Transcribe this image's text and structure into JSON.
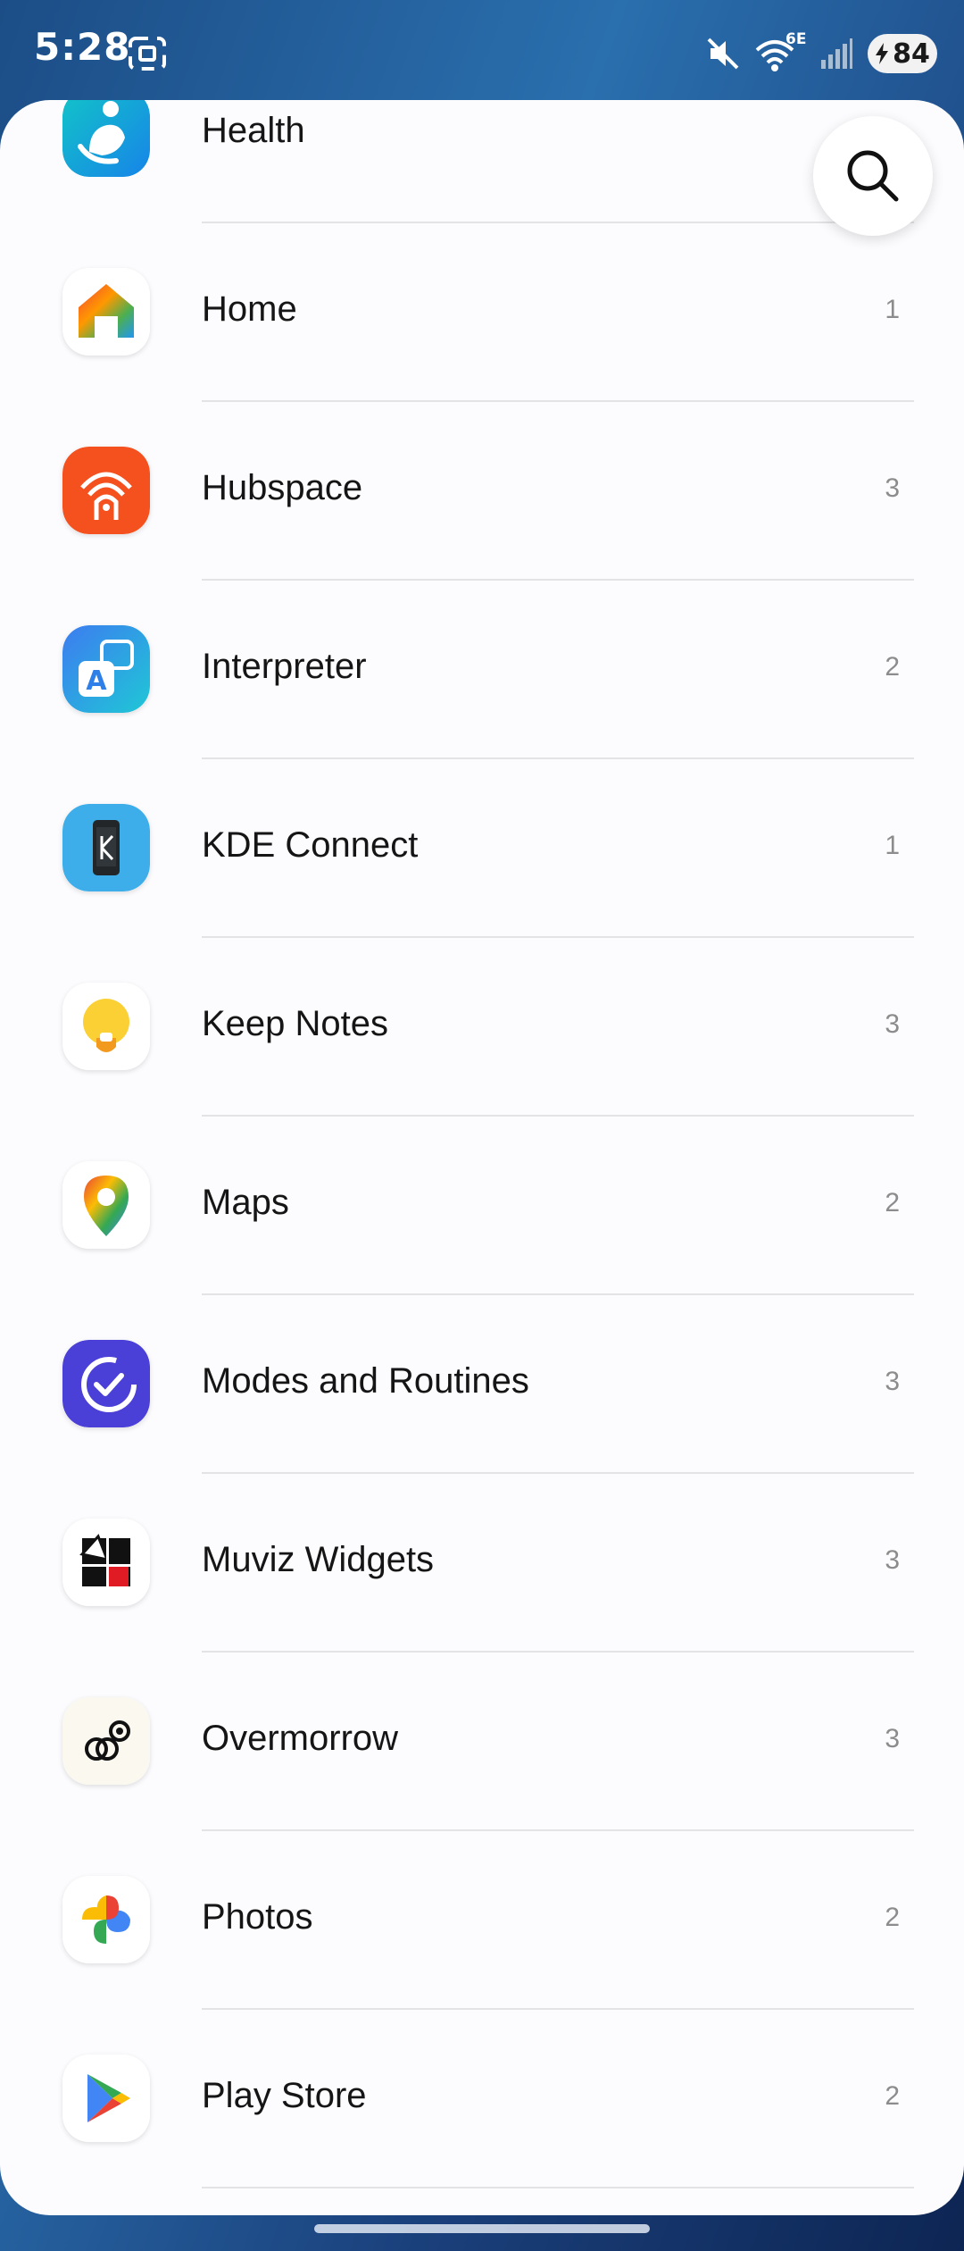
{
  "status_bar": {
    "time": "5:28",
    "network": "6E",
    "battery": "84"
  },
  "apps": [
    {
      "name": "Health",
      "count": "",
      "icon": "health-icon"
    },
    {
      "name": "Home",
      "count": "1",
      "icon": "home-icon"
    },
    {
      "name": "Hubspace",
      "count": "3",
      "icon": "hubspace-icon"
    },
    {
      "name": "Interpreter",
      "count": "2",
      "icon": "interpreter-icon"
    },
    {
      "name": "KDE Connect",
      "count": "1",
      "icon": "kde-connect-icon"
    },
    {
      "name": "Keep Notes",
      "count": "3",
      "icon": "keep-notes-icon"
    },
    {
      "name": "Maps",
      "count": "2",
      "icon": "maps-icon"
    },
    {
      "name": "Modes and Routines",
      "count": "3",
      "icon": "modes-routines-icon"
    },
    {
      "name": "Muviz Widgets",
      "count": "3",
      "icon": "muviz-icon"
    },
    {
      "name": "Overmorrow",
      "count": "3",
      "icon": "overmorrow-icon"
    },
    {
      "name": "Photos",
      "count": "2",
      "icon": "photos-icon"
    },
    {
      "name": "Play Store",
      "count": "2",
      "icon": "play-store-icon"
    }
  ]
}
